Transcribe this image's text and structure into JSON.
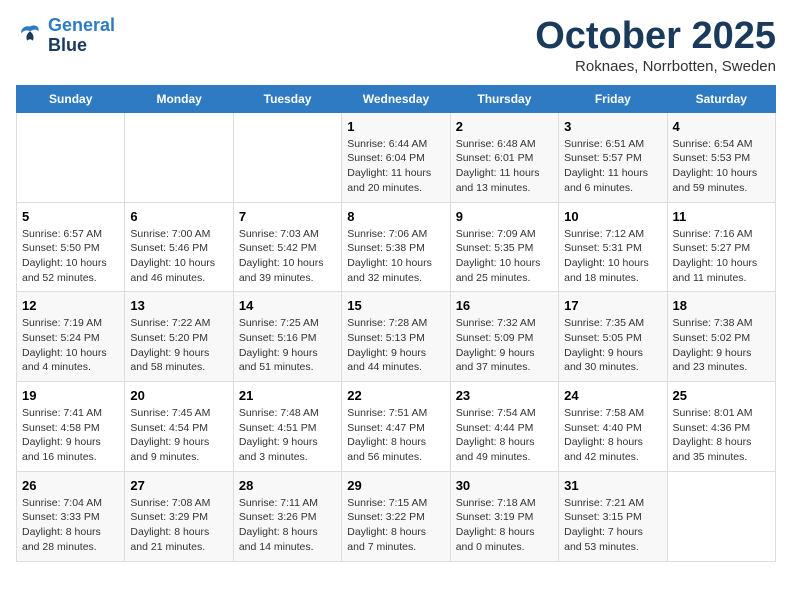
{
  "logo": {
    "line1": "General",
    "line2": "Blue"
  },
  "title": "October 2025",
  "location": "Roknaes, Norrbotten, Sweden",
  "weekdays": [
    "Sunday",
    "Monday",
    "Tuesday",
    "Wednesday",
    "Thursday",
    "Friday",
    "Saturday"
  ],
  "weeks": [
    [
      {
        "day": "",
        "info": ""
      },
      {
        "day": "",
        "info": ""
      },
      {
        "day": "",
        "info": ""
      },
      {
        "day": "1",
        "info": "Sunrise: 6:44 AM\nSunset: 6:04 PM\nDaylight: 11 hours and 20 minutes."
      },
      {
        "day": "2",
        "info": "Sunrise: 6:48 AM\nSunset: 6:01 PM\nDaylight: 11 hours and 13 minutes."
      },
      {
        "day": "3",
        "info": "Sunrise: 6:51 AM\nSunset: 5:57 PM\nDaylight: 11 hours and 6 minutes."
      },
      {
        "day": "4",
        "info": "Sunrise: 6:54 AM\nSunset: 5:53 PM\nDaylight: 10 hours and 59 minutes."
      }
    ],
    [
      {
        "day": "5",
        "info": "Sunrise: 6:57 AM\nSunset: 5:50 PM\nDaylight: 10 hours and 52 minutes."
      },
      {
        "day": "6",
        "info": "Sunrise: 7:00 AM\nSunset: 5:46 PM\nDaylight: 10 hours and 46 minutes."
      },
      {
        "day": "7",
        "info": "Sunrise: 7:03 AM\nSunset: 5:42 PM\nDaylight: 10 hours and 39 minutes."
      },
      {
        "day": "8",
        "info": "Sunrise: 7:06 AM\nSunset: 5:38 PM\nDaylight: 10 hours and 32 minutes."
      },
      {
        "day": "9",
        "info": "Sunrise: 7:09 AM\nSunset: 5:35 PM\nDaylight: 10 hours and 25 minutes."
      },
      {
        "day": "10",
        "info": "Sunrise: 7:12 AM\nSunset: 5:31 PM\nDaylight: 10 hours and 18 minutes."
      },
      {
        "day": "11",
        "info": "Sunrise: 7:16 AM\nSunset: 5:27 PM\nDaylight: 10 hours and 11 minutes."
      }
    ],
    [
      {
        "day": "12",
        "info": "Sunrise: 7:19 AM\nSunset: 5:24 PM\nDaylight: 10 hours and 4 minutes."
      },
      {
        "day": "13",
        "info": "Sunrise: 7:22 AM\nSunset: 5:20 PM\nDaylight: 9 hours and 58 minutes."
      },
      {
        "day": "14",
        "info": "Sunrise: 7:25 AM\nSunset: 5:16 PM\nDaylight: 9 hours and 51 minutes."
      },
      {
        "day": "15",
        "info": "Sunrise: 7:28 AM\nSunset: 5:13 PM\nDaylight: 9 hours and 44 minutes."
      },
      {
        "day": "16",
        "info": "Sunrise: 7:32 AM\nSunset: 5:09 PM\nDaylight: 9 hours and 37 minutes."
      },
      {
        "day": "17",
        "info": "Sunrise: 7:35 AM\nSunset: 5:05 PM\nDaylight: 9 hours and 30 minutes."
      },
      {
        "day": "18",
        "info": "Sunrise: 7:38 AM\nSunset: 5:02 PM\nDaylight: 9 hours and 23 minutes."
      }
    ],
    [
      {
        "day": "19",
        "info": "Sunrise: 7:41 AM\nSunset: 4:58 PM\nDaylight: 9 hours and 16 minutes."
      },
      {
        "day": "20",
        "info": "Sunrise: 7:45 AM\nSunset: 4:54 PM\nDaylight: 9 hours and 9 minutes."
      },
      {
        "day": "21",
        "info": "Sunrise: 7:48 AM\nSunset: 4:51 PM\nDaylight: 9 hours and 3 minutes."
      },
      {
        "day": "22",
        "info": "Sunrise: 7:51 AM\nSunset: 4:47 PM\nDaylight: 8 hours and 56 minutes."
      },
      {
        "day": "23",
        "info": "Sunrise: 7:54 AM\nSunset: 4:44 PM\nDaylight: 8 hours and 49 minutes."
      },
      {
        "day": "24",
        "info": "Sunrise: 7:58 AM\nSunset: 4:40 PM\nDaylight: 8 hours and 42 minutes."
      },
      {
        "day": "25",
        "info": "Sunrise: 8:01 AM\nSunset: 4:36 PM\nDaylight: 8 hours and 35 minutes."
      }
    ],
    [
      {
        "day": "26",
        "info": "Sunrise: 7:04 AM\nSunset: 3:33 PM\nDaylight: 8 hours and 28 minutes."
      },
      {
        "day": "27",
        "info": "Sunrise: 7:08 AM\nSunset: 3:29 PM\nDaylight: 8 hours and 21 minutes."
      },
      {
        "day": "28",
        "info": "Sunrise: 7:11 AM\nSunset: 3:26 PM\nDaylight: 8 hours and 14 minutes."
      },
      {
        "day": "29",
        "info": "Sunrise: 7:15 AM\nSunset: 3:22 PM\nDaylight: 8 hours and 7 minutes."
      },
      {
        "day": "30",
        "info": "Sunrise: 7:18 AM\nSunset: 3:19 PM\nDaylight: 8 hours and 0 minutes."
      },
      {
        "day": "31",
        "info": "Sunrise: 7:21 AM\nSunset: 3:15 PM\nDaylight: 7 hours and 53 minutes."
      },
      {
        "day": "",
        "info": ""
      }
    ]
  ]
}
